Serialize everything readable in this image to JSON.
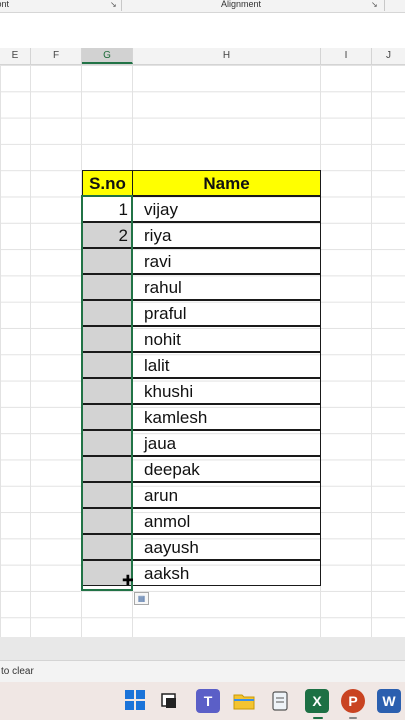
{
  "ribbon": {
    "font_group": "Font",
    "alignment_group": "Alignment"
  },
  "columns": [
    "E",
    "F",
    "G",
    "H",
    "I",
    "J"
  ],
  "selected_column": "G",
  "table": {
    "headers": {
      "sno": "S.no",
      "name": "Name"
    },
    "rows": [
      {
        "sno": "1",
        "name": "vijay"
      },
      {
        "sno": "2",
        "name": "riya"
      },
      {
        "sno": "",
        "name": "ravi"
      },
      {
        "sno": "",
        "name": "rahul"
      },
      {
        "sno": "",
        "name": "praful"
      },
      {
        "sno": "",
        "name": "nohit"
      },
      {
        "sno": "",
        "name": "lalit"
      },
      {
        "sno": "",
        "name": "khushi"
      },
      {
        "sno": "",
        "name": "kamlesh"
      },
      {
        "sno": "",
        "name": "jaua"
      },
      {
        "sno": "",
        "name": "deepak"
      },
      {
        "sno": "",
        "name": "arun"
      },
      {
        "sno": "",
        "name": "anmol"
      },
      {
        "sno": "",
        "name": "aayush"
      },
      {
        "sno": "",
        "name": "aaksh"
      }
    ]
  },
  "status_bar": {
    "text": "to clear"
  },
  "taskbar": {
    "icons": [
      "windows-start-icon",
      "task-view-icon",
      "teams-icon",
      "file-explorer-icon",
      "notepad-icon",
      "excel-icon",
      "powerpoint-icon",
      "word-icon"
    ]
  },
  "colors": {
    "header_fill": "#ffff00",
    "selection_border": "#217346",
    "fill_gray": "#d3d3d3"
  }
}
